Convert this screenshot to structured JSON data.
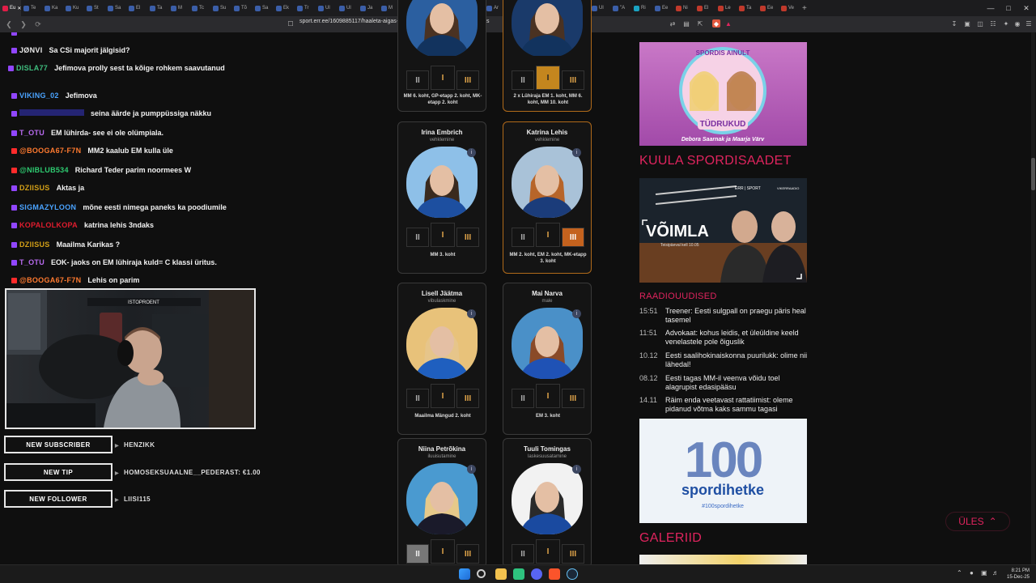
{
  "browser": {
    "tabs": [
      "Eu",
      "Te",
      "Ka",
      "Ku",
      "St",
      "Sa",
      "El",
      "Ta",
      "M",
      "Tc",
      "Su",
      "Tõ",
      "Sa",
      "Ek",
      "Tr",
      "Ul",
      "Ul",
      "Ja",
      "M",
      "Ta",
      "Jõ",
      "Sc",
      "Ee",
      "Ar",
      "La",
      "Au",
      "Ul",
      "Ka",
      "Ul",
      "\"A",
      "Ri",
      "Ee",
      "Ni",
      "El",
      "Le",
      "Ta",
      "Ee",
      "Ve"
    ],
    "url": "sport.err.ee/1609885117/haaleta-aigas-aasta-sportlane-2025-rahvahaaletus"
  },
  "chat": [
    {
      "user": "JØNVI",
      "text": "Sa CSi majorit jälgisid?",
      "user_color": "#e9e9e9",
      "plat": "twitch"
    },
    {
      "user": "DISLA77",
      "text": "Jefimova prolly sest ta kõige rohkem saavutanud",
      "user_color": "#3fbf7f",
      "plat": "twitch"
    },
    {
      "user": "VIKING_02",
      "text": "Jefimova",
      "user_color": "#4aa3ff",
      "plat": "twitch"
    },
    {
      "user": "",
      "text": "seina äärde ja pumppüssiga näkku",
      "user_color": "#3a3ad8",
      "plat": "twitch"
    },
    {
      "user": "T_OTU",
      "text": "EM lühirda- see ei ole olümpiala.",
      "user_color": "#b86bf0",
      "plat": "twitch"
    },
    {
      "user": "@BOOGA67-F7N",
      "text": "MM2 kaalub EM kulla üle",
      "user_color": "#ff7a2f",
      "plat": "youtube"
    },
    {
      "user": "@NIBLUB534",
      "text": "Richard Teder parim noormees W",
      "user_color": "#2ecc71",
      "plat": "youtube"
    },
    {
      "user": "DZIISUS",
      "text": "Aktas ja",
      "user_color": "#d4a017",
      "plat": "twitch"
    },
    {
      "user": "SIGMAZYLOON",
      "text": "mõne eesti nimega paneks ka poodiumile",
      "user_color": "#4aa3ff",
      "plat": "twitch"
    },
    {
      "user": "KOPALOLKOPA",
      "text": "katrina lehis 3ndaks",
      "user_color": "#e01c2e",
      "plat": "twitch"
    },
    {
      "user": "DZIISUS",
      "text": "Maailma Karikas ?",
      "user_color": "#d4a017",
      "plat": "twitch"
    },
    {
      "user": "T_OTU",
      "text": "EOK- jaoks on EM lühiraja kuld= C klassi üritus.",
      "user_color": "#b86bf0",
      "plat": "twitch"
    },
    {
      "user": "@BOOGA67-F7N",
      "text": "Lehis on parim",
      "user_color": "#ff7a2f",
      "plat": "youtube"
    }
  ],
  "webcam": {
    "label": "ISTOPROENT"
  },
  "alerts": [
    {
      "label": "NEW SUBSCRIBER",
      "value": "HENZIKK"
    },
    {
      "label": "NEW TIP",
      "value": "HOMOSEKSUAALNE__PEDERAST: €1.00"
    },
    {
      "label": "NEW FOLLOWER",
      "value": "LIISI115"
    }
  ],
  "cards_top": [
    {
      "result": "MM 6. koht, GP-etapp 2. koht, MK-etapp 2. koht"
    },
    {
      "result": "2 x Lühiraja EM 1. koht, MM 6. koht, MM 10. koht"
    }
  ],
  "cards": [
    {
      "name": "Irina Embrich",
      "sport": "vehklemine",
      "result": "MM 3. koht",
      "selected": false,
      "vote": 0
    },
    {
      "name": "Katrina Lehis",
      "sport": "vehklemine",
      "result": "MM 2. koht, EM 2. koht, MK-etapp 3. koht",
      "selected": true,
      "vote": 3
    },
    {
      "name": "Lisell Jäätma",
      "sport": "vibulaskmine",
      "result": "Maailma Mängud 2. koht",
      "selected": false,
      "vote": 0
    },
    {
      "name": "Mai Narva",
      "sport": "male",
      "result": "EM 3. koht",
      "selected": false,
      "vote": 0
    },
    {
      "name": "Niina Petrõkina",
      "sport": "iluuisutamine",
      "result": "",
      "selected": false,
      "vote": 1
    },
    {
      "name": "Tuuli Tomingas",
      "sport": "laskesuusatamine",
      "result": "",
      "selected": false,
      "vote": 0
    }
  ],
  "vote_labels": [
    "II",
    "I",
    "III"
  ],
  "podcast": {
    "title": "TÜDRUKUD",
    "top_text": "SPORDIS AINULT",
    "hosts": "Debora Saarnak ja Maarja Värv"
  },
  "sections": {
    "broadcast": "KUULA SPORDISAADET",
    "radio": "RAADIOUUDISED",
    "gallery": "GALERIID"
  },
  "voimla": {
    "title": "VÕIMLA",
    "sub": "Teisipäeval kell 10.05",
    "brand": "ERR | SPORT",
    "brand2": "VIKERRAADIO"
  },
  "news": [
    {
      "time": "15:51",
      "text": "Treener: Eesti sulgpall on praegu päris heal tasemel"
    },
    {
      "time": "11:51",
      "text": "Advokaat: kohus leidis, et üleüldine keeld venelastele pole õiguslik"
    },
    {
      "time": "10.12",
      "text": "Eesti saalihokinaiskonna puurilukk: olime nii lähedal!"
    },
    {
      "time": "08.12",
      "text": "Eesti tagas MM-il veenva võidu toel alagrupist edasipääsu"
    },
    {
      "time": "14.11",
      "text": "Räim enda veetavast rattatiimist: oleme pidanud võtma kaks sammu tagasi"
    }
  ],
  "hetke": {
    "number": "100",
    "title": "spordihetke",
    "tag": "#100spordihetke"
  },
  "ules": "ÜLES",
  "clock": {
    "time": "8:21 PM",
    "date": "15-Dec-25"
  }
}
